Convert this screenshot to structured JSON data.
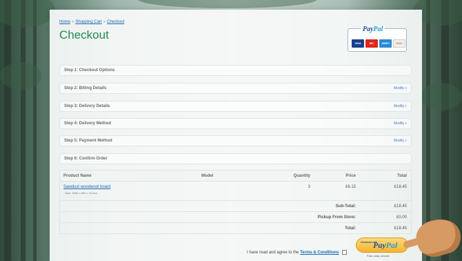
{
  "breadcrumb": {
    "items": [
      "Home",
      "Shopping Cart",
      "Checkout"
    ],
    "separator": "»"
  },
  "page_title": "Checkout",
  "paypal_logo": {
    "pay": "Pay",
    "pal": "Pal"
  },
  "card_icons": [
    "VISA",
    "MC",
    "AMEX",
    "DISC"
  ],
  "steps": [
    {
      "label": "Step 1: Checkout Options",
      "modify": ""
    },
    {
      "label": "Step 2: Billing Details",
      "modify": "Modify »"
    },
    {
      "label": "Step 3: Delivery Details",
      "modify": "Modify »"
    },
    {
      "label": "Step 4: Delivery Method",
      "modify": "Modify »"
    },
    {
      "label": "Step 5: Payment Method",
      "modify": "Modify »"
    },
    {
      "label": "Step 6: Confirm Order",
      "modify": ""
    }
  ],
  "order": {
    "headers": {
      "name": "Product Name",
      "model": "Model",
      "quantity": "Quantity",
      "price": "Price",
      "total": "Total"
    },
    "item": {
      "name": "Sawdust woodwool board",
      "option": "- Size: 2000 x 600 x 15 mm",
      "model": "",
      "quantity": "3",
      "price": "£6.15",
      "total": "£18.45"
    },
    "totals": [
      {
        "label": "Sub-Total:",
        "value": "£18.45"
      },
      {
        "label": "Pickup From Store:",
        "value": "£0.00"
      },
      {
        "label": "Total:",
        "value": "£18.45"
      }
    ]
  },
  "agree": {
    "text": "I have read and agree to the",
    "link": "Terms & Conditions"
  },
  "checkout_button": {
    "small": "Checkout with",
    "pay": "Pay",
    "pal": "Pal",
    "tagline": "Fast, easy, secure."
  }
}
